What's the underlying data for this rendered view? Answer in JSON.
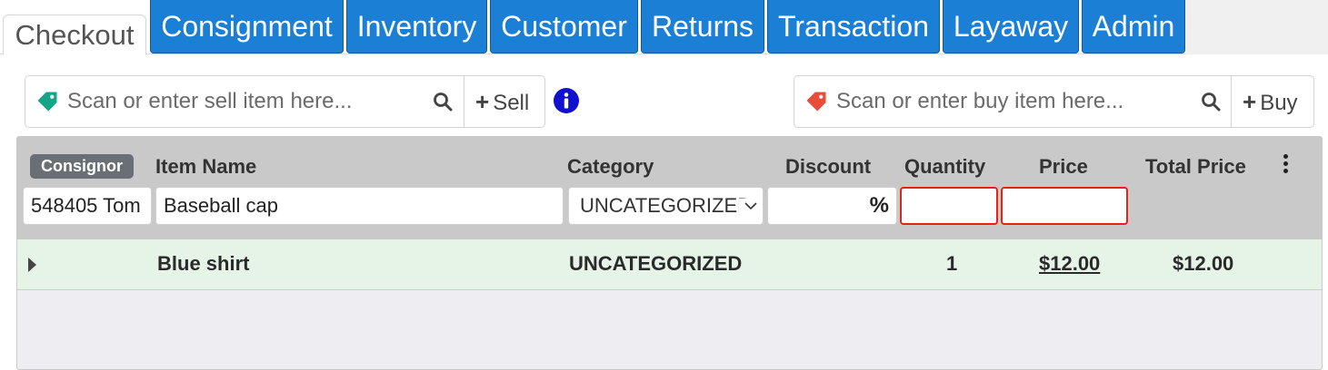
{
  "tabs": [
    {
      "label": "Checkout",
      "active": true
    },
    {
      "label": "Consignment",
      "active": false
    },
    {
      "label": "Inventory",
      "active": false
    },
    {
      "label": "Customer",
      "active": false
    },
    {
      "label": "Returns",
      "active": false
    },
    {
      "label": "Transaction",
      "active": false
    },
    {
      "label": "Layaway",
      "active": false
    },
    {
      "label": "Admin",
      "active": false
    }
  ],
  "sell_scan": {
    "placeholder": "Scan or enter sell item here...",
    "button_label": "Sell",
    "tag_color": "#17a589"
  },
  "buy_scan": {
    "placeholder": "Scan or enter buy item here...",
    "button_label": "Buy",
    "tag_color": "#e74c3c"
  },
  "table": {
    "headers": {
      "consignor": "Consignor",
      "item_name": "Item Name",
      "category": "Category",
      "discount": "Discount",
      "quantity": "Quantity",
      "price": "Price",
      "total_price": "Total Price"
    },
    "entry": {
      "consignor": "548405 Tom",
      "item_name": "Baseball cap",
      "category": "UNCATEGORIZED",
      "discount": "",
      "discount_symbol": "%",
      "quantity": "",
      "price": ""
    },
    "rows": [
      {
        "item_name": "Blue shirt",
        "category": "UNCATEGORIZED",
        "quantity": "1",
        "price": "$12.00",
        "total_price": "$12.00"
      }
    ]
  },
  "colors": {
    "tab_blue": "#1c7fd6",
    "row_green": "#e6f4e8",
    "invalid_red": "#e2231a",
    "info_blue": "#1010d0"
  }
}
